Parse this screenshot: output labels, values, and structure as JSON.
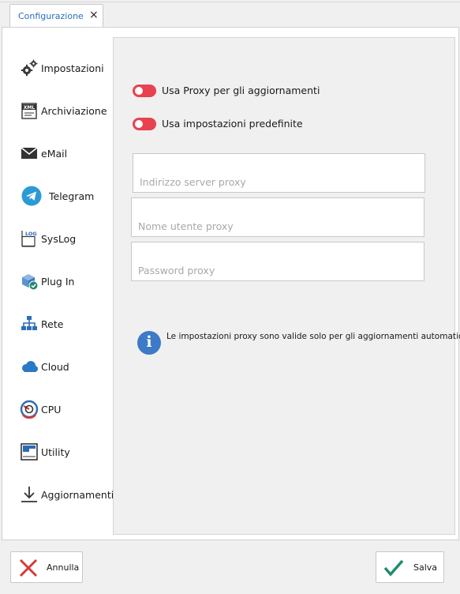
{
  "tab": {
    "title": "Configurazione",
    "close_glyph": "×"
  },
  "sidebar": {
    "items": [
      {
        "label": "Impostazioni",
        "icon": "gears-icon"
      },
      {
        "label": "Archiviazione",
        "icon": "xml-icon"
      },
      {
        "label": "eMail",
        "icon": "envelope-icon"
      },
      {
        "label": "Telegram",
        "icon": "telegram-icon"
      },
      {
        "label": "SysLog",
        "icon": "log-icon"
      },
      {
        "label": "Plug In",
        "icon": "plugin-icon"
      },
      {
        "label": "Rete",
        "icon": "network-icon"
      },
      {
        "label": "Cloud",
        "icon": "cloud-icon"
      },
      {
        "label": "CPU",
        "icon": "cpu-gauge-icon"
      },
      {
        "label": "Utility",
        "icon": "window-icon"
      },
      {
        "label": "Aggiornamenti",
        "icon": "download-icon",
        "selected": true
      }
    ],
    "icon_glyphs": {
      "xml": "XML",
      "log": "LOG"
    }
  },
  "panel": {
    "toggle_proxy": {
      "label": "Usa Proxy per gli aggiornamenti",
      "on": false
    },
    "toggle_defaults": {
      "label": "Usa impostazioni predefinite",
      "on": false
    },
    "fields": {
      "server": {
        "placeholder": "Indirizzo server proxy",
        "value": ""
      },
      "username": {
        "placeholder": "Nome utente proxy",
        "value": ""
      },
      "password": {
        "placeholder": "Password proxy",
        "value": ""
      }
    },
    "info": {
      "text": "Le impostazioni proxy sono valide solo per gli aggiornamenti automatici",
      "glyph": "i"
    }
  },
  "footer": {
    "cancel_label": "Annulla",
    "save_label": "Salva"
  },
  "colors": {
    "accent": "#2a6ebb",
    "toggle_off": "#e8414f",
    "info": "#3d7ac7",
    "cancel_red": "#d63a3a",
    "save_green": "#1f8a6e"
  }
}
